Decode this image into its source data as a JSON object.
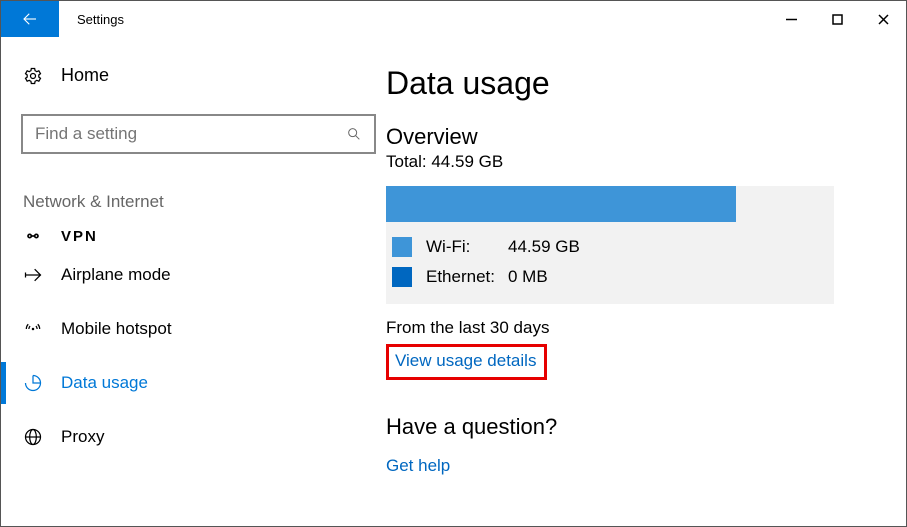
{
  "titlebar": {
    "title": "Settings"
  },
  "sidebar": {
    "home_label": "Home",
    "search_placeholder": "Find a setting",
    "category": "Network & Internet",
    "items": {
      "vpn": "VPN",
      "airplane": "Airplane mode",
      "hotspot": "Mobile hotspot",
      "datausage": "Data usage",
      "proxy": "Proxy"
    }
  },
  "content": {
    "page_title": "Data usage",
    "overview_title": "Overview",
    "total_label": "Total: 44.59 GB",
    "wifi_label": "Wi-Fi:",
    "wifi_value": "44.59 GB",
    "eth_label": "Ethernet:",
    "eth_value": "0 MB",
    "period": "From the last 30 days",
    "view_details": "View usage details",
    "question": "Have a question?",
    "get_help": "Get help"
  },
  "chart_data": {
    "type": "bar",
    "categories": [
      "Wi-Fi",
      "Ethernet"
    ],
    "values": [
      44.59,
      0
    ],
    "unit": "GB",
    "title": "Data usage overview",
    "total": 44.59
  }
}
